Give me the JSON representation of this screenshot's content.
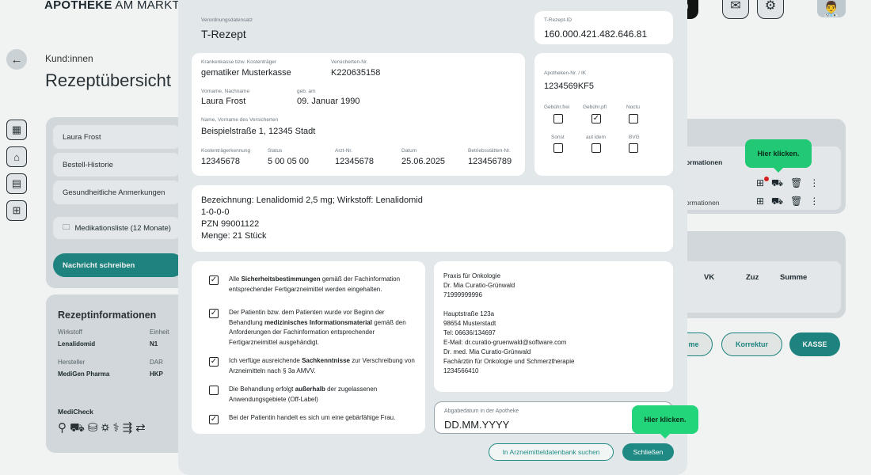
{
  "background": {
    "brand": {
      "bold": "APOTHEKE",
      "light": " AM MARKT"
    },
    "breadcrumb": "Kund:innen",
    "page_title": "Rezeptübersicht",
    "left_rows": [
      "Laura Frost",
      "Bestell-Historie",
      "Gesundheitliche Anmerkungen"
    ],
    "medication_list": "Medikationsliste (12 Monate)",
    "message_button": "Nachricht schreiben",
    "rx_info": {
      "title": "Rezeptinformationen",
      "labels": [
        "Wirkstoff",
        "Einheit",
        "Hersteller",
        "DAR"
      ],
      "values": [
        "Lenalidomid",
        "N1",
        "MediGen Pharma",
        "HKP"
      ]
    },
    "medicheck": "MediCheck",
    "table_header": "ormationen",
    "table_row2": "ormationen",
    "sum_headers": [
      "VK",
      "Zuz",
      "Summe"
    ],
    "buttons": {
      "partial": "me",
      "correction": "Korrektur",
      "checkout": "KASSE"
    },
    "hint": "Hier klicken."
  },
  "modal": {
    "dataset_label": "Verordnungsdatensatz",
    "dataset_value": "T-Rezept",
    "rx_id_label": "T-Rezept-ID",
    "rx_id_value": "160.000.421.482.646.81",
    "insurer_label": "Krankenkasse bzw. Kostenträger",
    "insurer_value": "gematiker Musterkasse",
    "insured_no_label": "Versicherten-Nr.",
    "insured_no_value": "K220635158",
    "name_label": "Vorname, Nachname",
    "name_value": "Laura Frost",
    "dob_label": "geb. am",
    "dob_value": "09. Januar 1990",
    "address_label": "Name, Vorname des Versicherten",
    "address_value": "Beispielstraße 1, 12345 Stadt",
    "row_labels": [
      "Kostenträgerkennung",
      "Status",
      "Arzt-Nr.",
      "Datum",
      "Betriebsstätten-Nr."
    ],
    "row_values": [
      "12345678",
      "5 00 05 00",
      "12345678",
      "25.06.2025",
      "123456789"
    ],
    "pharmacy_label": "Apotheken-Nr. / IK",
    "pharmacy_value": "1234569KF5",
    "flags_row1": {
      "labels": [
        "Gebühr.frei",
        "Gebühr.pfl",
        "Noctu"
      ],
      "checked": [
        false,
        true,
        false
      ]
    },
    "flags_row2": {
      "labels": [
        "Sonst",
        "aut idem",
        "BVG"
      ],
      "checked": [
        false,
        false,
        false
      ]
    },
    "medication": {
      "line1": "Bezeichnung: Lenalidomid 2,5 mg; Wirkstoff: Lenalidomid",
      "line2": "1-0-0-0",
      "line3": "PZN 99001122",
      "line4": "Menge: 21 Stück"
    },
    "checks": [
      {
        "checked": true,
        "pre": "Alle ",
        "bold": "Sicherheitsbestimmungen",
        "post": " gemäß der Fachinformation entsprechender Fertigarzneimittel werden eingehalten."
      },
      {
        "checked": true,
        "pre": "Der Patientin bzw. dem Patienten wurde vor Beginn der Behandlung ",
        "bold": "medizinisches Informationsmaterial",
        "post": " gemäß den Anforderungen der Fachinformation entsprechender Fertigarzneimittel ausgehändigt."
      },
      {
        "checked": true,
        "pre": "Ich verfüge ausreichende ",
        "bold": "Sachkenntnisse",
        "post": " zur Verschreibung von Arzneimitteln nach § 3a AMVV."
      },
      {
        "checked": false,
        "pre": "Die Behandlung erfolgt ",
        "bold": "außerhalb",
        "post": " der zugelassenen Anwendungsgebiete (Off-Label)"
      },
      {
        "checked": true,
        "pre": "Bei der Patientin handelt es sich um eine gebärfähige Frau.",
        "bold": "",
        "post": ""
      }
    ],
    "doctor": "Praxis für Onkologie\nDr. Mia Curatio-Grünwald\n71999999996\n\nHauptstraße 123a\n98654 Musterstadt\nTel: 06636/134697\nE-Mail: dr.curatio-gruenwald@software.com\nDr. med. Mia Curatio-Grünwald\nFachärztin für Onkologie und Schmerztherapie\n1234566410",
    "dispense_label": "Abgabedatum in der Apotheke",
    "dispense_placeholder": "DD.MM.YYYY",
    "search_button": "In Arzneimitteldatenbank suchen",
    "close_button": "Schließen",
    "hint": "Hier klicken."
  },
  "colors": {
    "accent": "#1f8a84",
    "hint": "#22d47a"
  }
}
